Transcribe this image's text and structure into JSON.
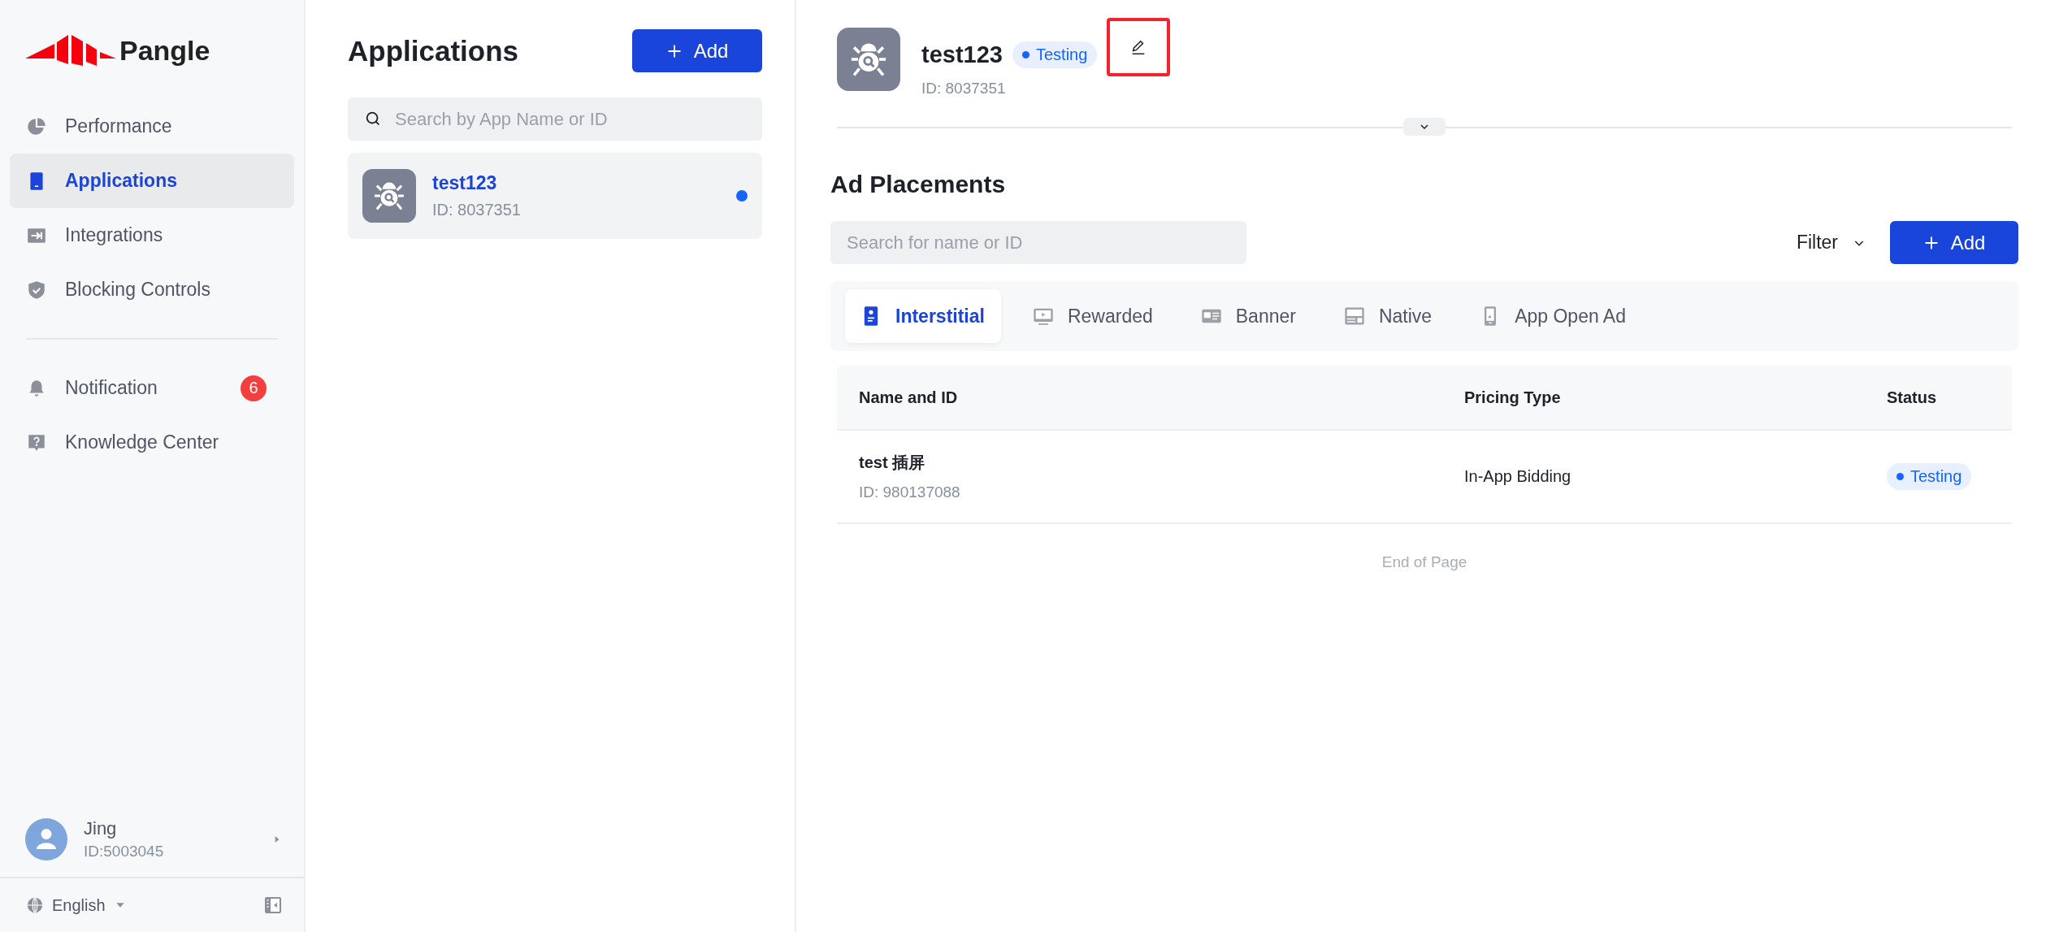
{
  "logo": {
    "text": "Pangle"
  },
  "nav": [
    {
      "label": "Performance",
      "kind": "pie",
      "selected": false
    },
    {
      "label": "Applications",
      "kind": "phone",
      "selected": true
    },
    {
      "label": "Integrations",
      "kind": "import",
      "selected": false
    },
    {
      "label": "Blocking Controls",
      "kind": "shield",
      "selected": false
    }
  ],
  "nav_secondary": [
    {
      "label": "Notification",
      "kind": "bell",
      "badge": "6",
      "selected": false
    },
    {
      "label": "Knowledge Center",
      "kind": "help",
      "selected": false
    }
  ],
  "user": {
    "name": "Jing",
    "id": "ID:5003045"
  },
  "language": {
    "label": "English"
  },
  "apps_panel": {
    "title": "Applications",
    "add_button": "Add",
    "search": {
      "placeholder": "Search by App Name or ID"
    },
    "apps": [
      {
        "name": "test123",
        "id": "ID: 8037351",
        "selected": true,
        "unread": true
      }
    ]
  },
  "app_header": {
    "name": "test123",
    "id": "ID: 8037351",
    "status": "Testing",
    "edit_highlighted": true,
    "expanded": false
  },
  "placements": {
    "title": "Ad Placements",
    "search": {
      "placeholder": "Search for name or ID"
    },
    "filter": "Filter",
    "add_button": "Add",
    "tabs": [
      {
        "label": "Interstitial",
        "kind": "interstitial",
        "selected": true
      },
      {
        "label": "Rewarded",
        "kind": "rewarded",
        "selected": false
      },
      {
        "label": "Banner",
        "kind": "banner",
        "selected": false
      },
      {
        "label": "Native",
        "kind": "native",
        "selected": false
      },
      {
        "label": "App Open Ad",
        "kind": "appopen",
        "selected": false
      }
    ],
    "table": {
      "columns": [
        "Name and ID",
        "Pricing Type",
        "Status"
      ],
      "rows": [
        {
          "name": "test 插屏",
          "id": "ID: 980137088",
          "pricing": "In-App Bidding",
          "status": "Testing"
        }
      ]
    },
    "footer": "End of Page"
  }
}
